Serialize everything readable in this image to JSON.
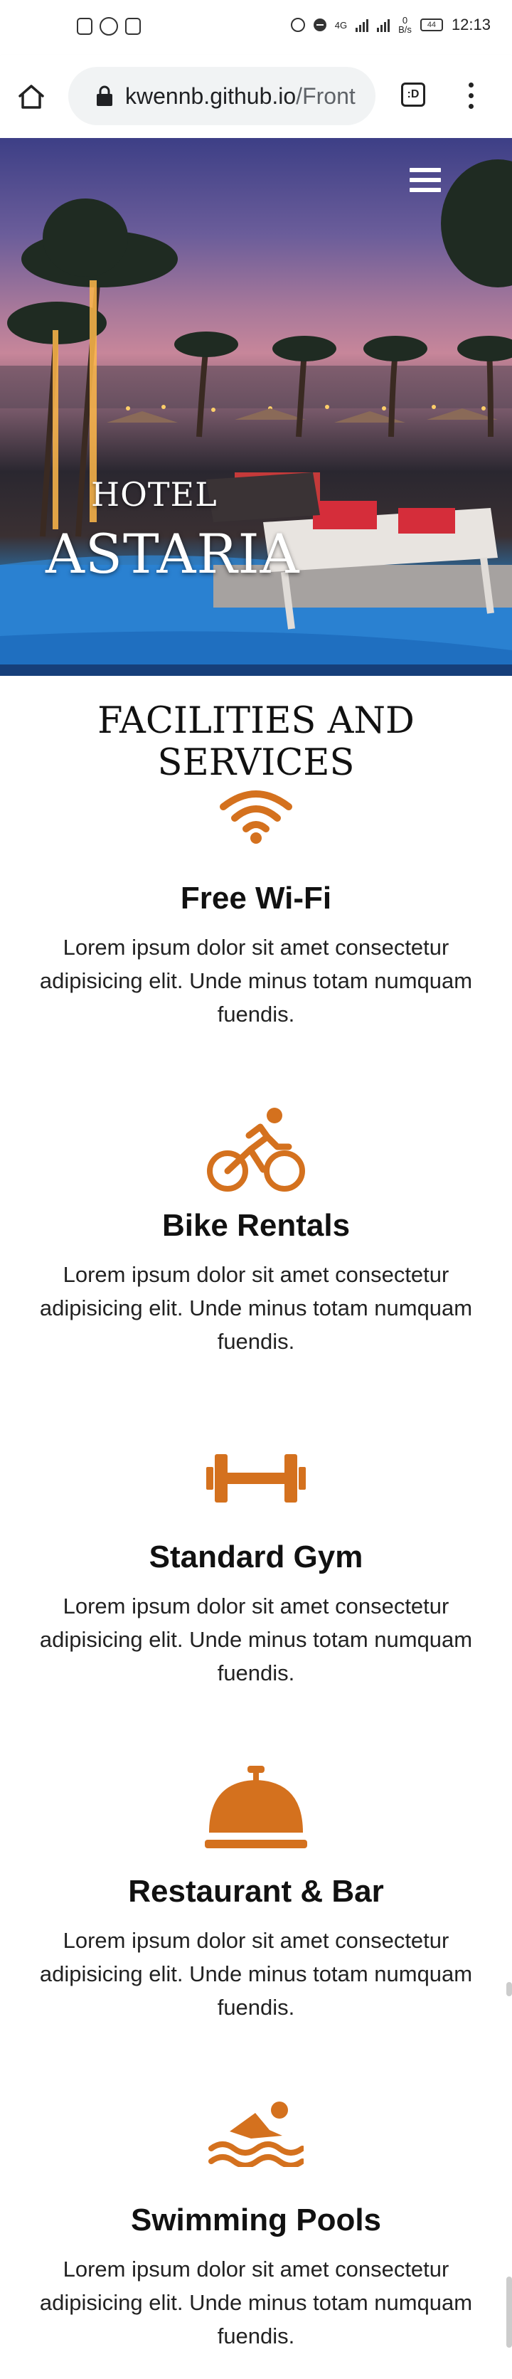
{
  "status_bar": {
    "time": "12:13",
    "network": "4G",
    "speed_value": "0",
    "speed_unit": "B/s",
    "battery": "44"
  },
  "browser": {
    "url_host": "kwennb.github.io",
    "url_rest": "/Front",
    "tabs_label": ":D"
  },
  "hero": {
    "subtitle": "HOTEL",
    "title": "ASTARIA"
  },
  "facilities": {
    "heading": "FACILITIES AND SERVICES",
    "items": [
      {
        "icon": "wifi-icon",
        "title": "Free Wi-Fi",
        "text": "Lorem ipsum dolor sit amet consectetur adipisicing elit. Unde minus totam numquam fuendis."
      },
      {
        "icon": "bicycle-icon",
        "title": "Bike Rentals",
        "text": "Lorem ipsum dolor sit amet consectetur adipisicing elit. Unde minus totam numquam fuendis."
      },
      {
        "icon": "dumbbell-icon",
        "title": "Standard Gym",
        "text": "Lorem ipsum dolor sit amet consectetur adipisicing elit. Unde minus totam numquam fuendis."
      },
      {
        "icon": "concierge-bell-icon",
        "title": "Restaurant & Bar",
        "text": "Lorem ipsum dolor sit amet consectetur adipisicing elit. Unde minus totam numquam fuendis."
      },
      {
        "icon": "swimmer-icon",
        "title": "Swimming Pools",
        "text": "Lorem ipsum dolor sit amet consectetur adipisicing elit. Unde minus totam numquam fuendis."
      }
    ]
  },
  "colors": {
    "accent": "#d4711e"
  }
}
